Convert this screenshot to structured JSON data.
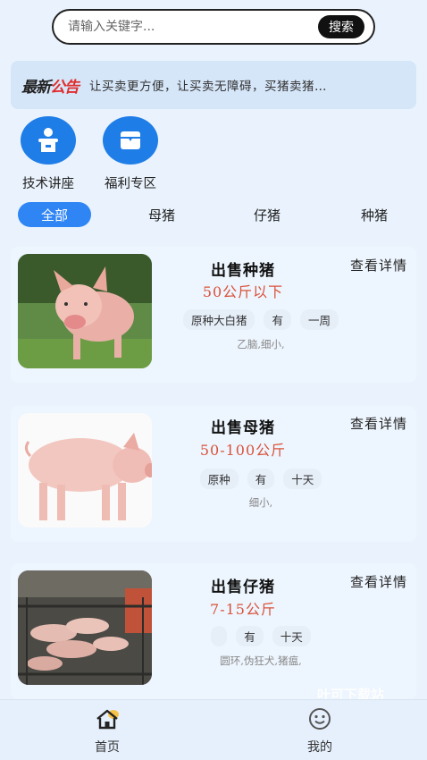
{
  "search": {
    "placeholder": "请输入关键字...",
    "button": "搜索"
  },
  "notice": {
    "logo_part1": "最新",
    "logo_part2": "公告",
    "text": "让买卖更方便，让买卖无障碍，买猪卖猪…"
  },
  "quick_links": [
    {
      "label": "技术讲座",
      "icon": "lecture-icon"
    },
    {
      "label": "福利专区",
      "icon": "gift-box-icon"
    }
  ],
  "tabs": [
    {
      "label": "全部",
      "active": true
    },
    {
      "label": "母猪",
      "active": false
    },
    {
      "label": "仔猪",
      "active": false
    },
    {
      "label": "种猪",
      "active": false
    }
  ],
  "listings": [
    {
      "title": "出售种猪",
      "detail_link": "查看详情",
      "weight": "50公斤以下",
      "tags": [
        "原种大白猪",
        "有",
        "一周"
      ],
      "desc": "乙脑,细小,"
    },
    {
      "title": "出售母猪",
      "detail_link": "查看详情",
      "weight": "50-100公斤",
      "tags": [
        "原种",
        "有",
        "十天"
      ],
      "desc": "细小,"
    },
    {
      "title": "出售仔猪",
      "detail_link": "查看详情",
      "weight": "7-15公斤",
      "tags": [
        "",
        "有",
        "十天"
      ],
      "desc": "圆环,伪狂犬,猪瘟,"
    }
  ],
  "watermark": "叶可下载站",
  "bottom_nav": [
    {
      "label": "首页",
      "icon": "home-icon",
      "active": true
    },
    {
      "label": "我的",
      "icon": "smiley-icon",
      "active": false
    }
  ],
  "colors": {
    "accent": "#2f85f4",
    "price": "#d9533a",
    "background": "#eaf3fd"
  }
}
